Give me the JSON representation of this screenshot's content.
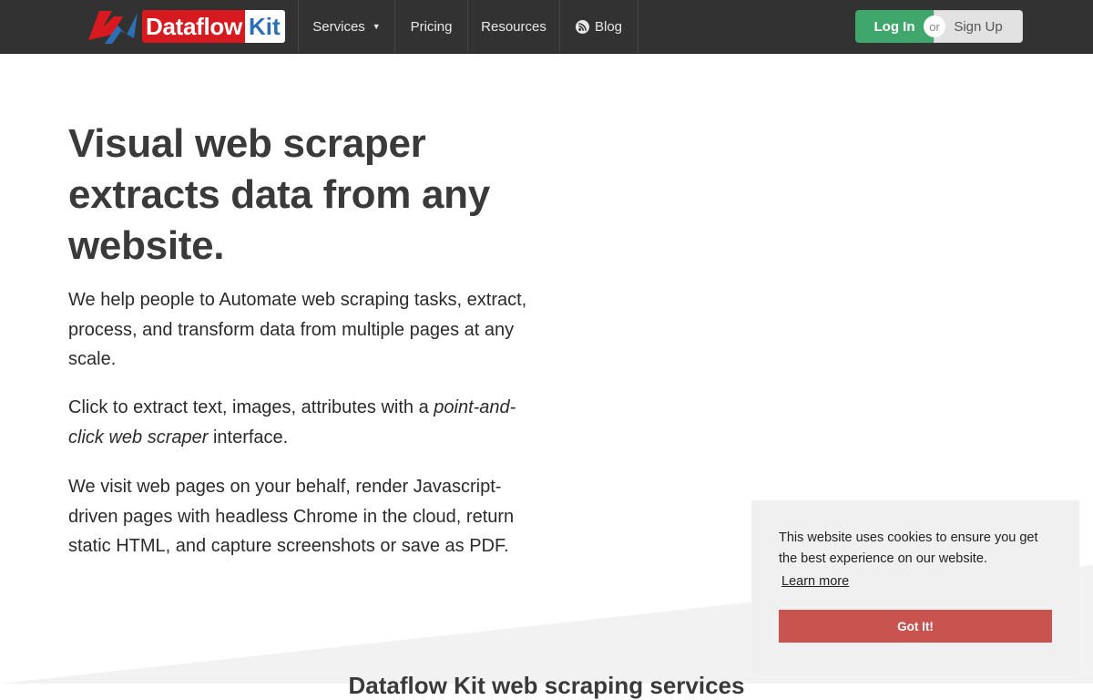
{
  "brand": {
    "logo_word": "Dataflow",
    "logo_kit": "Kit",
    "colors": {
      "red": "#d71920",
      "blue": "#2c6fb7"
    }
  },
  "nav": {
    "items": [
      {
        "label": "Services",
        "icon": "chevron-down-icon"
      },
      {
        "label": "Pricing"
      },
      {
        "label": "Resources"
      },
      {
        "label": "Blog",
        "icon": "rss-icon"
      }
    ],
    "login_label": "Log In",
    "or_label": "or",
    "signup_label": "Sign Up",
    "colors": {
      "bar": "#323232",
      "login": "#3fa76b",
      "signup": "#e2e2e2"
    }
  },
  "hero": {
    "title": "Visual web scraper extracts data from any website.",
    "p1": "We help people to Automate web scraping tasks, extract, process, and transform data from multiple pages at any scale.",
    "p2_before": "Click to extract text, images, attributes with a ",
    "p2_em": "point-and-click web scraper",
    "p2_after": " interface.",
    "p3": "We visit web pages on your behalf, render Javascript-driven pages with headless Chrome in the cloud, return static HTML, and capture screenshots or save as PDF."
  },
  "section2": {
    "heading": "Dataflow Kit web scraping services"
  },
  "cookie": {
    "message": "This website uses cookies to ensure you get the best experience on our website.",
    "learn_more": "Learn more",
    "accept": "Got It!",
    "button_color": "#c9534f"
  }
}
